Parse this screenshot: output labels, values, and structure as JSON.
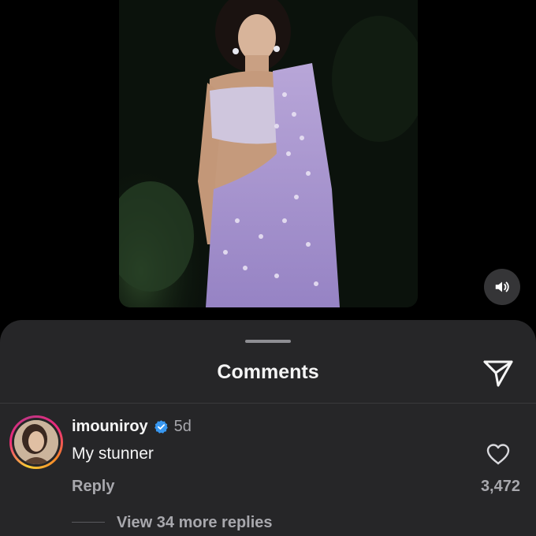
{
  "post": {
    "media_description": "photo of woman in lavender embellished saree",
    "sound_icon": "speaker-icon"
  },
  "comments_sheet": {
    "title": "Comments",
    "share_icon": "paper-plane-icon"
  },
  "comments": [
    {
      "username": "imouniroy",
      "verified": true,
      "time_ago": "5d",
      "text": "My stunner",
      "reply_label": "Reply",
      "like_count": "3,472",
      "view_replies_label": "View 34 more replies"
    }
  ],
  "colors": {
    "sheet_bg": "#262628",
    "muted_text": "#a8a8ad",
    "verified_blue": "#3897f0"
  }
}
